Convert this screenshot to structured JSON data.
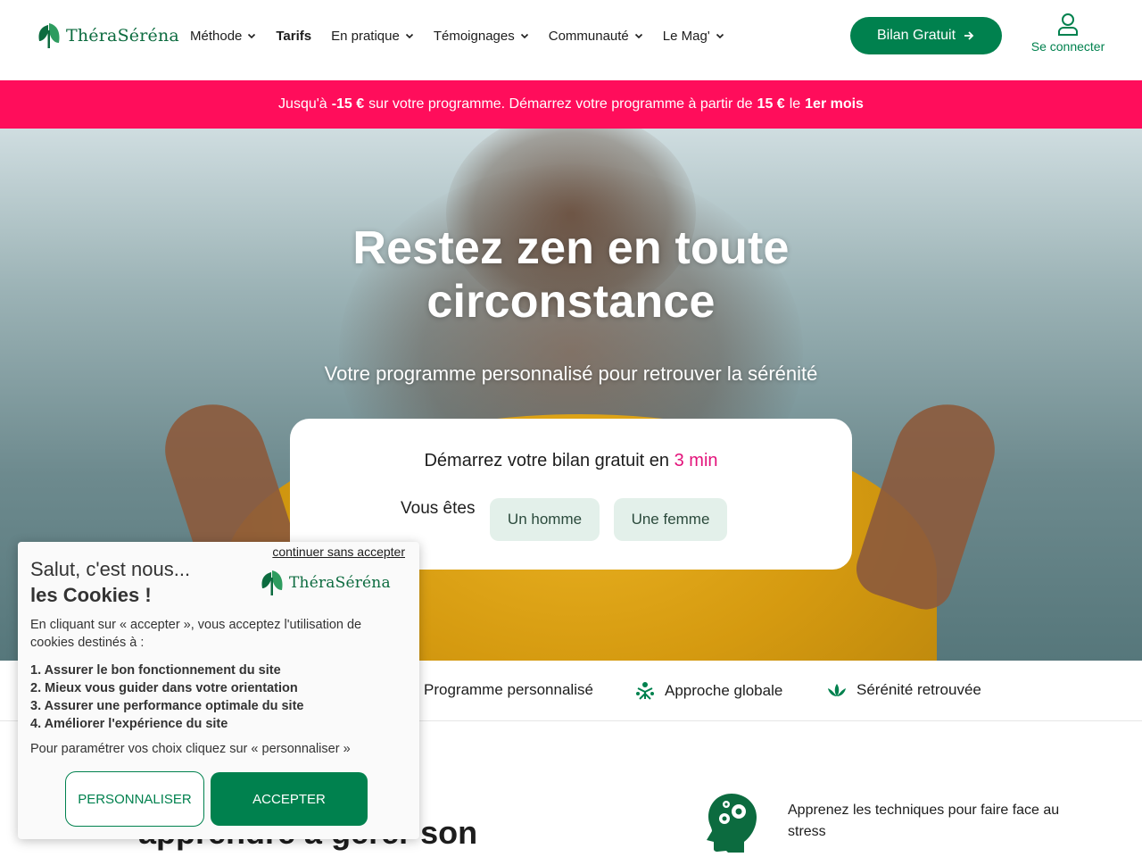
{
  "brand": {
    "name": "ThéraSéréna",
    "color": "#00814e"
  },
  "nav": {
    "items": [
      {
        "label": "Méthode",
        "dropdown": true
      },
      {
        "label": "Tarifs",
        "dropdown": false
      },
      {
        "label": "En pratique",
        "dropdown": true
      },
      {
        "label": "Témoignages",
        "dropdown": true
      },
      {
        "label": "Communauté",
        "dropdown": true
      },
      {
        "label": "Le Mag'",
        "dropdown": true
      }
    ],
    "cta_label": "Bilan Gratuit",
    "login_label": "Se connecter"
  },
  "promo": {
    "p1": "Jusqu'à",
    "b1": "-15 €",
    "p2": "sur votre programme. Démarrez votre programme à partir de",
    "b2": "15 €",
    "p3": "le",
    "b3": "1er mois",
    "bg_color": "#ff0d5b"
  },
  "hero": {
    "title_line1": "Restez zen en toute",
    "title_line2": "circonstance",
    "subtitle": "Votre programme personnalisé pour retrouver la sérénité",
    "bilan_title": "Démarrez votre bilan gratuit en",
    "bilan_accent": "3 min",
    "vous_label": "Vous êtes",
    "choice_man": "Un homme",
    "choice_woman": "Une femme"
  },
  "features": [
    {
      "label": "Programme personnalisé",
      "icon": "person-icon"
    },
    {
      "label": "Approche globale",
      "icon": "holistic-icon"
    },
    {
      "label": "Sérénité retrouvée",
      "icon": "lotus-icon"
    }
  ],
  "section": {
    "title_fragment": "apprendre à gérer son",
    "tech_text": "Apprenez les techniques pour faire face au stress"
  },
  "cookie": {
    "skip_label": "continuer sans accepter",
    "hello": "Salut, c'est nous...",
    "title": "les Cookies !",
    "intro": "En cliquant sur « accepter », vous acceptez l'utilisation de cookies destinés à :",
    "items": [
      "1. Assurer le bon fonctionnement du site",
      "2. Mieux vous guider dans votre orientation",
      "3. Assurer une performance optimale du site",
      "4. Améliorer l'expérience du site"
    ],
    "param_text": "Pour paramétrer vos choix cliquez sur « personnaliser »",
    "personalize_label": "PERSONNALISER",
    "accept_label": "ACCEPTER"
  }
}
